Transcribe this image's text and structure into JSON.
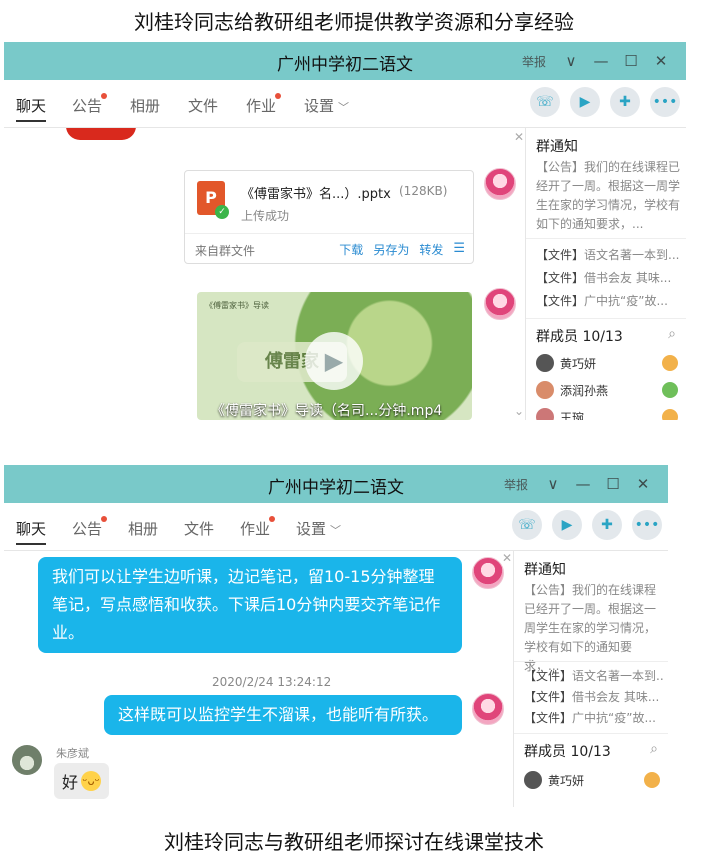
{
  "captions": {
    "top": "刘桂玲同志给教研组老师提供教学资源和分享经验",
    "bottom": "刘桂玲同志与教研组老师探讨在线课堂技术"
  },
  "window": {
    "title": "广州中学初二语文",
    "report": "举报",
    "controls": [
      "∨",
      "—",
      "☐",
      "✕"
    ]
  },
  "tabs": [
    {
      "label": "聊天",
      "active": true
    },
    {
      "label": "公告",
      "dot": true
    },
    {
      "label": "相册"
    },
    {
      "label": "文件"
    },
    {
      "label": "作业",
      "dot": true
    },
    {
      "label": "设置"
    }
  ],
  "tab_icons": [
    "phone-icon",
    "video-call-icon",
    "add-app-icon",
    "more-icon"
  ],
  "sidebar": {
    "notice_title": "群通知",
    "notice_text": "【公告】我们的在线课程已经开了一周。根据这一周学生在家的学习情况，学校有如下的通知要求，...",
    "files": [
      {
        "tag": "【文件】",
        "name": "语文名著一本到..."
      },
      {
        "tag": "【文件】",
        "name": "借书会友 其味..."
      },
      {
        "tag": "【文件】",
        "name": "广中抗“疫”故..."
      }
    ],
    "members_title_1": "群成员 10/13",
    "members_title_2": "群成员 10/13",
    "members": [
      "黄巧妍",
      "添润孙燕",
      "王琬"
    ]
  },
  "chat1": {
    "file": {
      "name": "《傅雷家书》名...）.pptx",
      "size": "(128KB)",
      "status": "上传成功",
      "source": "来自群文件",
      "actions": [
        "下载",
        "另存为",
        "转发"
      ],
      "icon_letter": "P"
    },
    "video": {
      "small_title": "《傅雷家书》导读",
      "box_text": "傅雷家",
      "name": "《傅雷家书》导读（名司...分钟.mp4"
    }
  },
  "chat2": {
    "msg1": "我们可以让学生边听课，边记笔记，留10-15分钟整理笔记，写点感悟和收获。下课后10分钟内要交齐笔记作业。",
    "timestamp": "2020/2/24 13:24:12",
    "msg2": "这样既可以监控学生不溜课，也能听有所获。",
    "reply_sender": "朱彦斌",
    "reply_text": "好"
  },
  "colors": {
    "titlebar": "#79c9c9",
    "bubble": "#1ab5ea",
    "link": "#2a8bd1"
  }
}
